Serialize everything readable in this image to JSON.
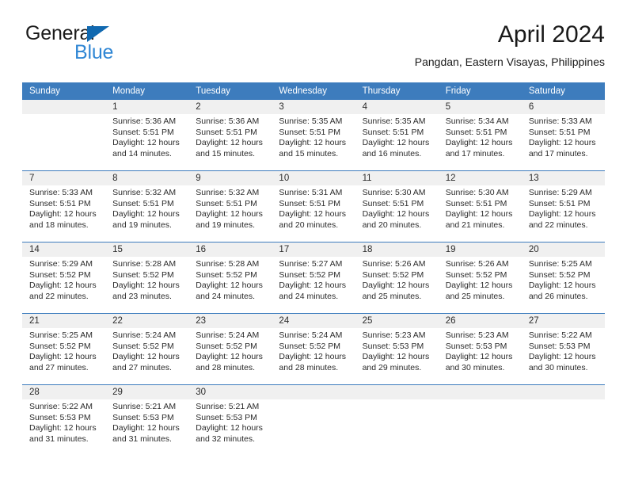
{
  "brand": {
    "word1": "General",
    "word2": "Blue",
    "triangle_color": "#1169b0",
    "word2_color": "#2f86d4"
  },
  "header": {
    "title": "April 2024",
    "subtitle": "Pangdan, Eastern Visayas, Philippines"
  },
  "colors": {
    "header_bar": "#3d7cbd",
    "day_number_band": "#f0f0f0",
    "text": "#2b2b2b"
  },
  "weekday_headers": [
    "Sunday",
    "Monday",
    "Tuesday",
    "Wednesday",
    "Thursday",
    "Friday",
    "Saturday"
  ],
  "weeks": [
    {
      "days": [
        {
          "number": "",
          "lines": []
        },
        {
          "number": "1",
          "lines": [
            "Sunrise: 5:36 AM",
            "Sunset: 5:51 PM",
            "Daylight: 12 hours",
            "and 14 minutes."
          ]
        },
        {
          "number": "2",
          "lines": [
            "Sunrise: 5:36 AM",
            "Sunset: 5:51 PM",
            "Daylight: 12 hours",
            "and 15 minutes."
          ]
        },
        {
          "number": "3",
          "lines": [
            "Sunrise: 5:35 AM",
            "Sunset: 5:51 PM",
            "Daylight: 12 hours",
            "and 15 minutes."
          ]
        },
        {
          "number": "4",
          "lines": [
            "Sunrise: 5:35 AM",
            "Sunset: 5:51 PM",
            "Daylight: 12 hours",
            "and 16 minutes."
          ]
        },
        {
          "number": "5",
          "lines": [
            "Sunrise: 5:34 AM",
            "Sunset: 5:51 PM",
            "Daylight: 12 hours",
            "and 17 minutes."
          ]
        },
        {
          "number": "6",
          "lines": [
            "Sunrise: 5:33 AM",
            "Sunset: 5:51 PM",
            "Daylight: 12 hours",
            "and 17 minutes."
          ]
        }
      ]
    },
    {
      "days": [
        {
          "number": "7",
          "lines": [
            "Sunrise: 5:33 AM",
            "Sunset: 5:51 PM",
            "Daylight: 12 hours",
            "and 18 minutes."
          ]
        },
        {
          "number": "8",
          "lines": [
            "Sunrise: 5:32 AM",
            "Sunset: 5:51 PM",
            "Daylight: 12 hours",
            "and 19 minutes."
          ]
        },
        {
          "number": "9",
          "lines": [
            "Sunrise: 5:32 AM",
            "Sunset: 5:51 PM",
            "Daylight: 12 hours",
            "and 19 minutes."
          ]
        },
        {
          "number": "10",
          "lines": [
            "Sunrise: 5:31 AM",
            "Sunset: 5:51 PM",
            "Daylight: 12 hours",
            "and 20 minutes."
          ]
        },
        {
          "number": "11",
          "lines": [
            "Sunrise: 5:30 AM",
            "Sunset: 5:51 PM",
            "Daylight: 12 hours",
            "and 20 minutes."
          ]
        },
        {
          "number": "12",
          "lines": [
            "Sunrise: 5:30 AM",
            "Sunset: 5:51 PM",
            "Daylight: 12 hours",
            "and 21 minutes."
          ]
        },
        {
          "number": "13",
          "lines": [
            "Sunrise: 5:29 AM",
            "Sunset: 5:51 PM",
            "Daylight: 12 hours",
            "and 22 minutes."
          ]
        }
      ]
    },
    {
      "days": [
        {
          "number": "14",
          "lines": [
            "Sunrise: 5:29 AM",
            "Sunset: 5:52 PM",
            "Daylight: 12 hours",
            "and 22 minutes."
          ]
        },
        {
          "number": "15",
          "lines": [
            "Sunrise: 5:28 AM",
            "Sunset: 5:52 PM",
            "Daylight: 12 hours",
            "and 23 minutes."
          ]
        },
        {
          "number": "16",
          "lines": [
            "Sunrise: 5:28 AM",
            "Sunset: 5:52 PM",
            "Daylight: 12 hours",
            "and 24 minutes."
          ]
        },
        {
          "number": "17",
          "lines": [
            "Sunrise: 5:27 AM",
            "Sunset: 5:52 PM",
            "Daylight: 12 hours",
            "and 24 minutes."
          ]
        },
        {
          "number": "18",
          "lines": [
            "Sunrise: 5:26 AM",
            "Sunset: 5:52 PM",
            "Daylight: 12 hours",
            "and 25 minutes."
          ]
        },
        {
          "number": "19",
          "lines": [
            "Sunrise: 5:26 AM",
            "Sunset: 5:52 PM",
            "Daylight: 12 hours",
            "and 25 minutes."
          ]
        },
        {
          "number": "20",
          "lines": [
            "Sunrise: 5:25 AM",
            "Sunset: 5:52 PM",
            "Daylight: 12 hours",
            "and 26 minutes."
          ]
        }
      ]
    },
    {
      "days": [
        {
          "number": "21",
          "lines": [
            "Sunrise: 5:25 AM",
            "Sunset: 5:52 PM",
            "Daylight: 12 hours",
            "and 27 minutes."
          ]
        },
        {
          "number": "22",
          "lines": [
            "Sunrise: 5:24 AM",
            "Sunset: 5:52 PM",
            "Daylight: 12 hours",
            "and 27 minutes."
          ]
        },
        {
          "number": "23",
          "lines": [
            "Sunrise: 5:24 AM",
            "Sunset: 5:52 PM",
            "Daylight: 12 hours",
            "and 28 minutes."
          ]
        },
        {
          "number": "24",
          "lines": [
            "Sunrise: 5:24 AM",
            "Sunset: 5:52 PM",
            "Daylight: 12 hours",
            "and 28 minutes."
          ]
        },
        {
          "number": "25",
          "lines": [
            "Sunrise: 5:23 AM",
            "Sunset: 5:53 PM",
            "Daylight: 12 hours",
            "and 29 minutes."
          ]
        },
        {
          "number": "26",
          "lines": [
            "Sunrise: 5:23 AM",
            "Sunset: 5:53 PM",
            "Daylight: 12 hours",
            "and 30 minutes."
          ]
        },
        {
          "number": "27",
          "lines": [
            "Sunrise: 5:22 AM",
            "Sunset: 5:53 PM",
            "Daylight: 12 hours",
            "and 30 minutes."
          ]
        }
      ]
    },
    {
      "days": [
        {
          "number": "28",
          "lines": [
            "Sunrise: 5:22 AM",
            "Sunset: 5:53 PM",
            "Daylight: 12 hours",
            "and 31 minutes."
          ]
        },
        {
          "number": "29",
          "lines": [
            "Sunrise: 5:21 AM",
            "Sunset: 5:53 PM",
            "Daylight: 12 hours",
            "and 31 minutes."
          ]
        },
        {
          "number": "30",
          "lines": [
            "Sunrise: 5:21 AM",
            "Sunset: 5:53 PM",
            "Daylight: 12 hours",
            "and 32 minutes."
          ]
        },
        {
          "number": "",
          "lines": []
        },
        {
          "number": "",
          "lines": []
        },
        {
          "number": "",
          "lines": []
        },
        {
          "number": "",
          "lines": []
        }
      ]
    }
  ]
}
